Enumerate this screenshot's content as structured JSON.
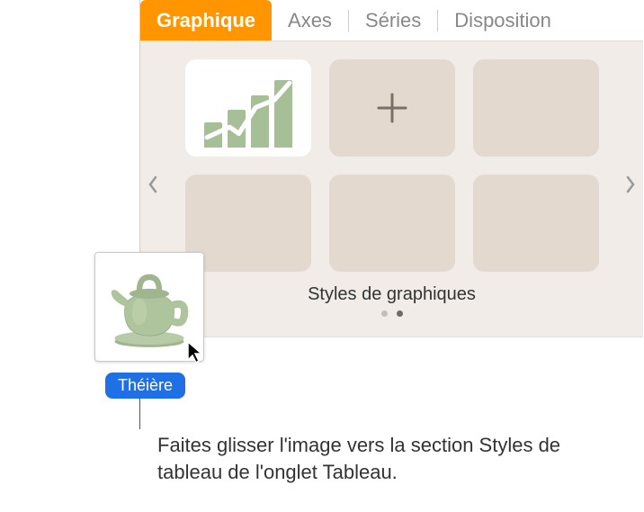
{
  "tabs": {
    "graphique": "Graphique",
    "axes": "Axes",
    "series": "Séries",
    "disposition": "Disposition"
  },
  "styles": {
    "label": "Styles de graphiques"
  },
  "drag": {
    "label": "Théière"
  },
  "callout": {
    "text": "Faites glisser l'image vers la section Styles de tableau de l'onglet Tableau."
  }
}
